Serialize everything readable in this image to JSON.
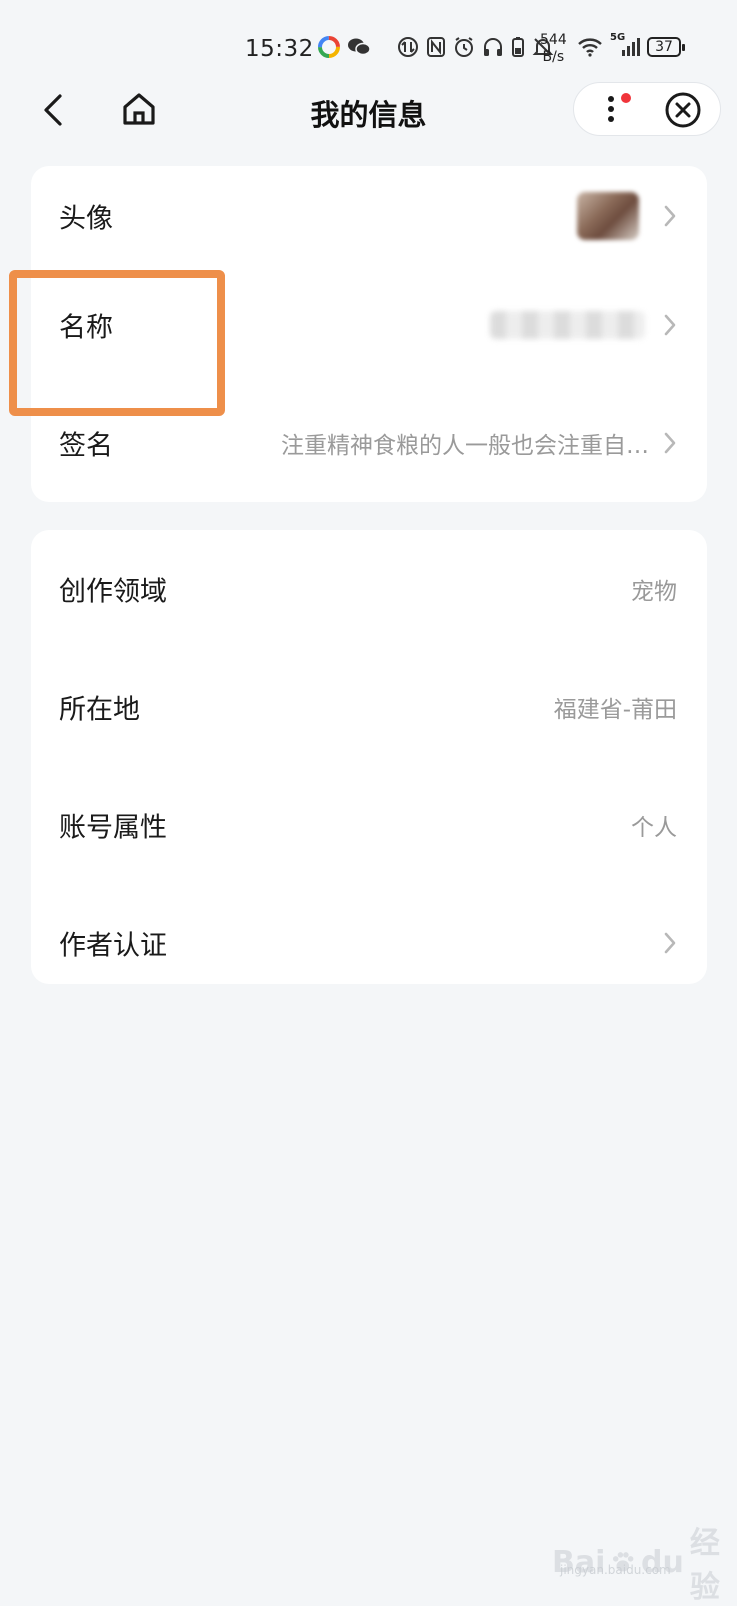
{
  "status_bar": {
    "time": "15:32",
    "net_speed_value": "544",
    "net_speed_unit": "B/s",
    "network": "5G",
    "battery": "37"
  },
  "nav": {
    "title": "我的信息"
  },
  "profile_rows": [
    {
      "label": "头像",
      "value": "",
      "chevron": true
    },
    {
      "label": "名称",
      "value": "",
      "chevron": true
    },
    {
      "label": "签名",
      "value": "注重精神食粮的人一般也会注重自…",
      "chevron": true
    }
  ],
  "info_rows": [
    {
      "label": "创作领域",
      "value": "宠物",
      "chevron": false
    },
    {
      "label": "所在地",
      "value": "福建省-莆田",
      "chevron": false
    },
    {
      "label": "账号属性",
      "value": "个人",
      "chevron": false
    },
    {
      "label": "作者认证",
      "value": "",
      "chevron": true
    }
  ],
  "watermark": {
    "brand": "Bai",
    "brand2": "du",
    "suffix": "经验",
    "site": "jingyan.baidu.com"
  },
  "colors": {
    "background": "#f4f6f8",
    "card": "#ffffff",
    "highlight": "#ee8f4a",
    "badge": "#f0343a",
    "secondary_text": "#9a9a9a"
  }
}
